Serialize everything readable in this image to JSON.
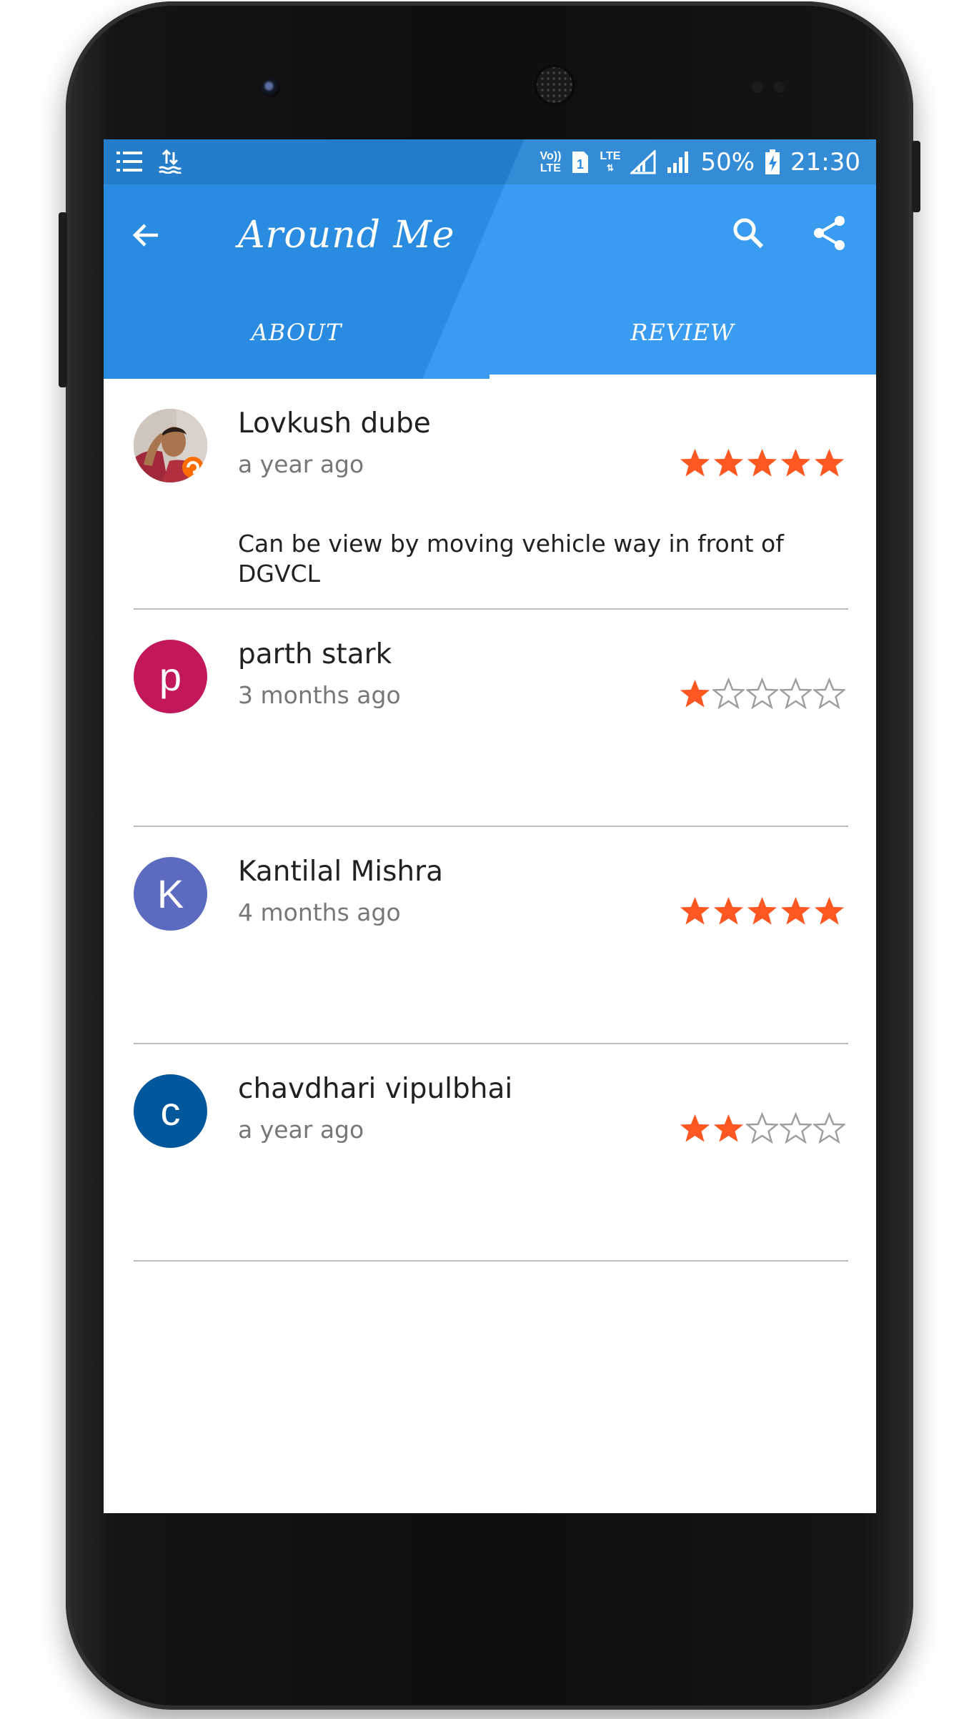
{
  "status_bar": {
    "volte": [
      "Vo))",
      "LTE"
    ],
    "sim": "1",
    "lte": "LTE",
    "battery": "50%",
    "time": "21:30"
  },
  "toolbar": {
    "title": "Around Me",
    "back_icon": "arrow-back-icon",
    "search_icon": "search-icon",
    "share_icon": "share-icon"
  },
  "tabs": [
    {
      "label": "ABOUT",
      "selected": false
    },
    {
      "label": "REVIEW",
      "selected": true
    }
  ],
  "reviews": [
    {
      "name": "Lovkush dube",
      "time": "a year ago",
      "rating": 5,
      "comment": "Can be view by moving vehicle way in front of DGVCL",
      "avatar_type": "photo"
    },
    {
      "name": "parth stark",
      "time": "3 months ago",
      "rating": 1,
      "comment": "",
      "avatar_letter": "p",
      "avatar_color": "#c2185b"
    },
    {
      "name": "Kantilal Mishra",
      "time": "4 months ago",
      "rating": 5,
      "comment": "",
      "avatar_letter": "K",
      "avatar_color": "#5c6bc0"
    },
    {
      "name": "chavdhari vipulbhai",
      "time": "a year ago",
      "rating": 2,
      "comment": "",
      "avatar_letter": "c",
      "avatar_color": "#01579b"
    }
  ],
  "colors": {
    "app_bar": "#3a9cf0",
    "star_filled": "#ff5722",
    "star_empty": "#9e9e9e"
  }
}
